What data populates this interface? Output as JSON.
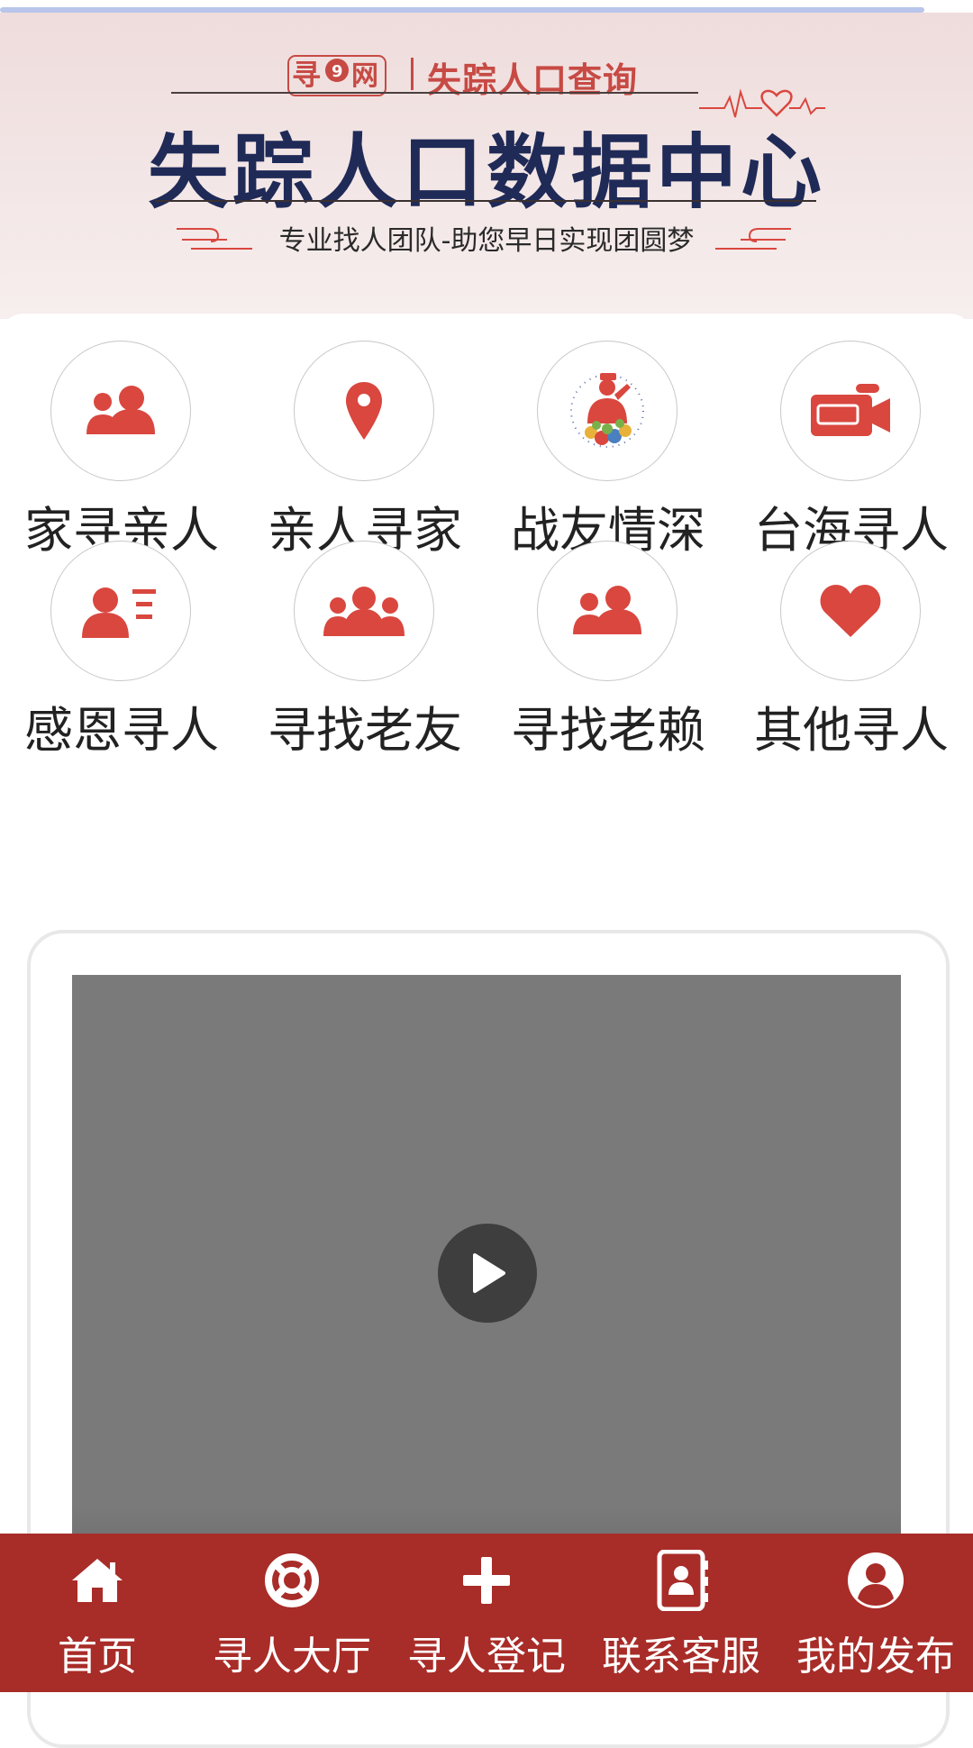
{
  "page_load": {
    "progress": 0.95,
    "color": "#b9c5ea"
  },
  "banner": {
    "logo_text": "寻亲网",
    "subtitle": "失踪人口查询",
    "title": "失踪人口数据中心",
    "tagline": "专业找人团队-助您早日实现团圆梦",
    "colors": {
      "accent": "#c74a44",
      "title": "#1f2a57",
      "background": "#efdcdc"
    }
  },
  "categories": [
    {
      "label": "家寻亲人",
      "icon": "two-people-icon"
    },
    {
      "label": "亲人寻家",
      "icon": "location-pin-icon"
    },
    {
      "label": "战友情深",
      "icon": "saluting-soldier-icon"
    },
    {
      "label": "台海寻人",
      "icon": "video-camera-icon"
    },
    {
      "label": "感恩寻人",
      "icon": "contact-card-icon"
    },
    {
      "label": "寻找老友",
      "icon": "group-icon"
    },
    {
      "label": "寻找老赖",
      "icon": "two-people-icon"
    },
    {
      "label": "其他寻人",
      "icon": "heart-icon"
    }
  ],
  "category_icon_color": "#d9473f",
  "video": {
    "play_icon": "play-icon",
    "background": "#7a7a7a"
  },
  "bottom_nav": {
    "background": "#a82c28",
    "items": [
      {
        "label": "首页",
        "icon": "home-icon"
      },
      {
        "label": "寻人大厅",
        "icon": "lifebuoy-icon"
      },
      {
        "label": "寻人登记",
        "icon": "plus-icon"
      },
      {
        "label": "联系客服",
        "icon": "contact-book-icon"
      },
      {
        "label": "我的发布",
        "icon": "user-circle-icon"
      }
    ]
  }
}
